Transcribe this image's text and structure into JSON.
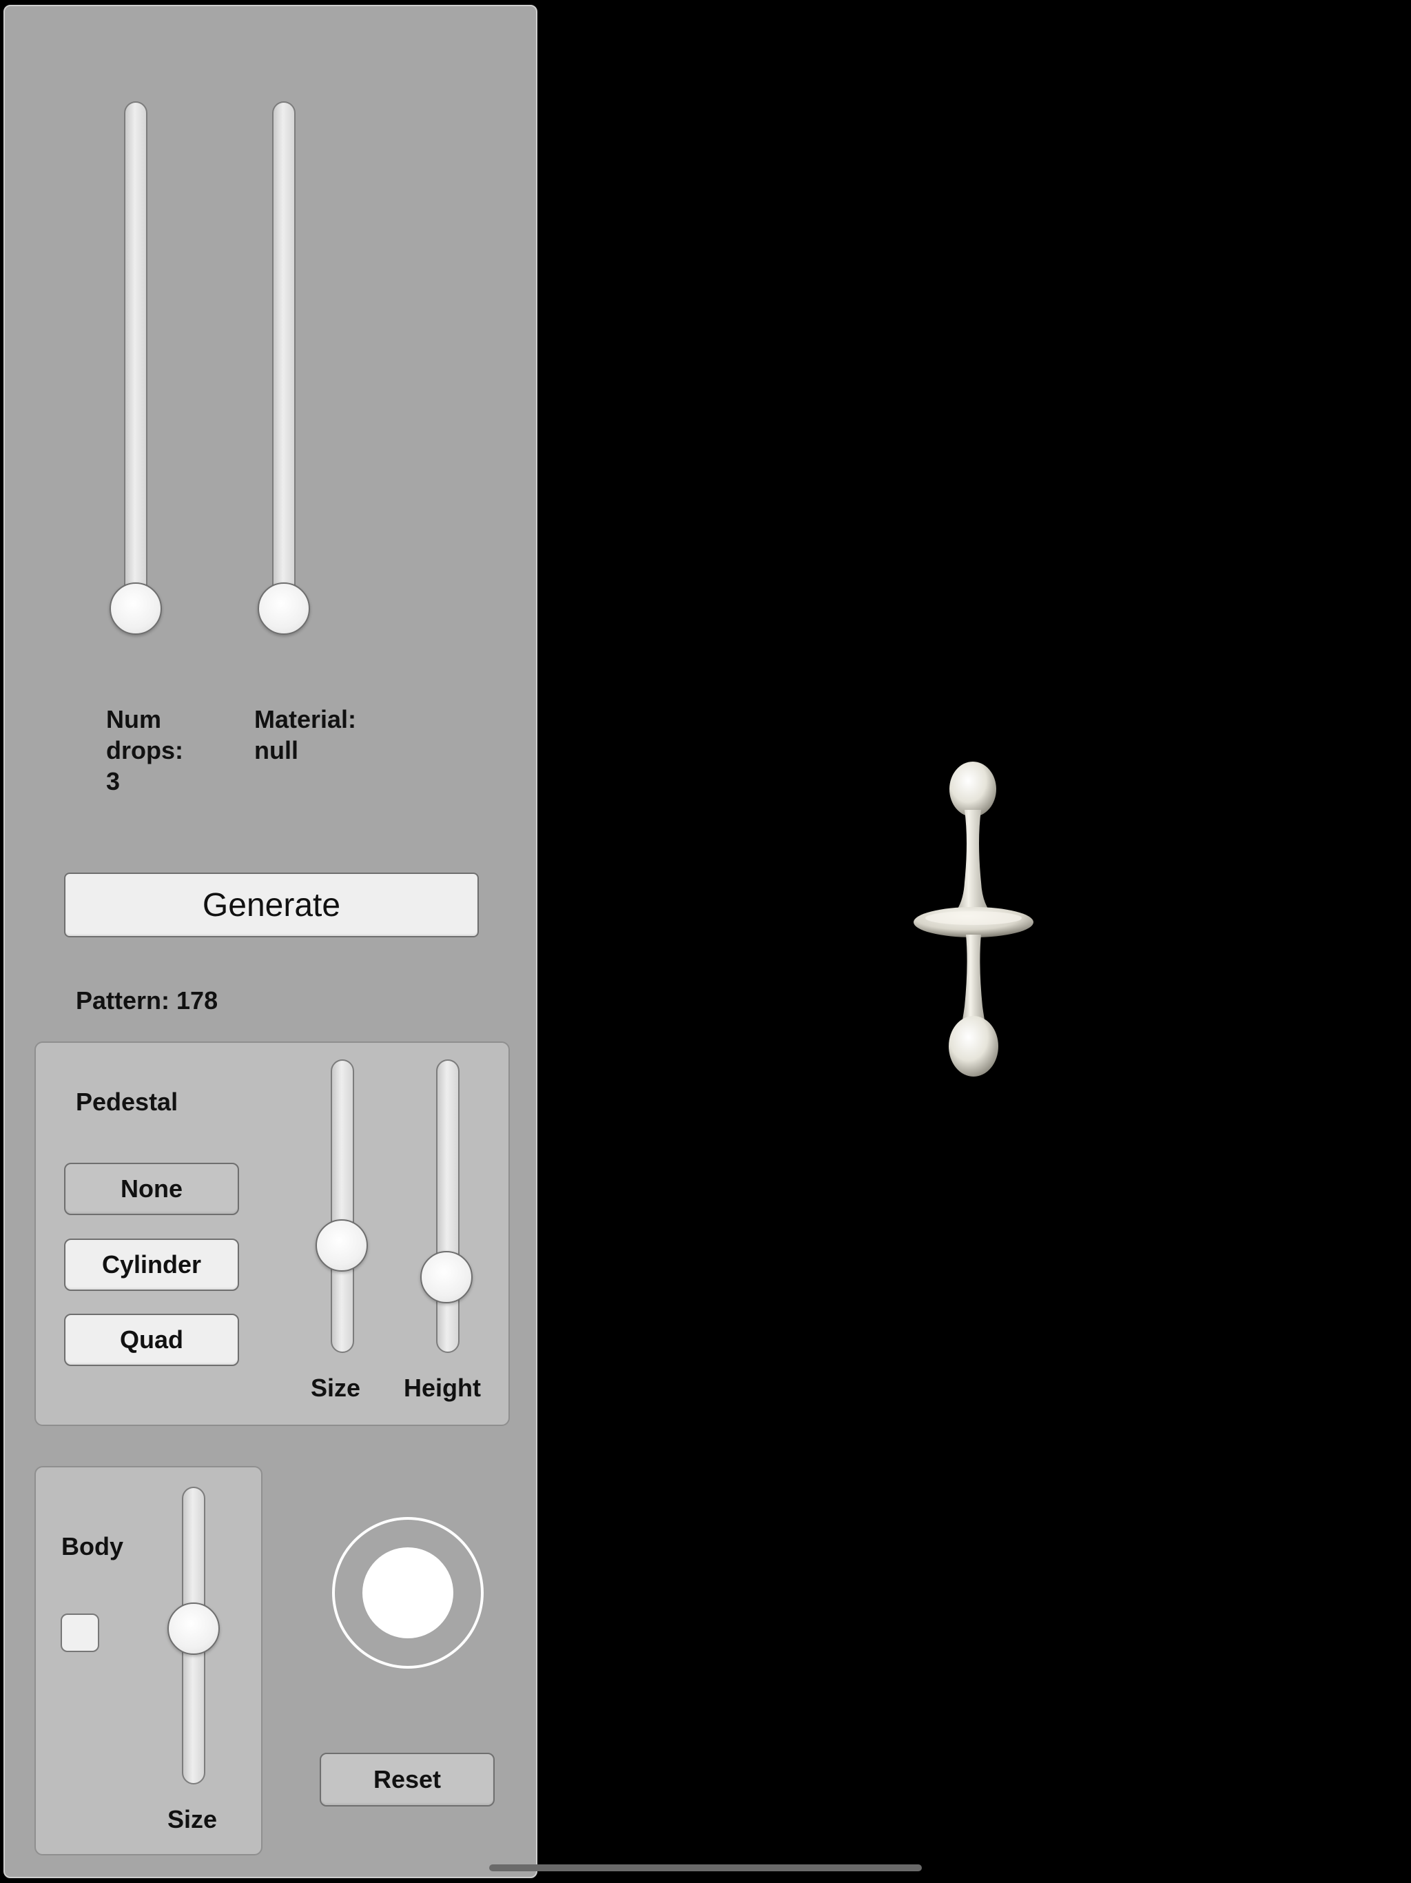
{
  "sliders": {
    "num_drops": {
      "label_lines": [
        "Num",
        "drops:",
        "3"
      ],
      "value_fraction": 0.0
    },
    "material": {
      "label_lines": [
        "Material:",
        "null"
      ],
      "value_fraction": 0.0
    }
  },
  "generate_button": {
    "label": "Generate"
  },
  "pattern_label": "Pattern: 178",
  "pedestal": {
    "title": "Pedestal",
    "buttons": [
      "None",
      "Cylinder",
      "Quad"
    ],
    "size_label": "Size",
    "height_label": "Height",
    "size_fraction": 0.36,
    "height_fraction": 0.25
  },
  "body": {
    "title": "Body",
    "size_label": "Size",
    "size_fraction": 0.55,
    "checkbox_checked": false
  },
  "reset_button": {
    "label": "Reset"
  },
  "colors": {
    "panel": "#a6a6a6",
    "viewport": "#000000",
    "object": "#e8e6dc"
  },
  "icons": {
    "joystick": "joystick-icon"
  }
}
